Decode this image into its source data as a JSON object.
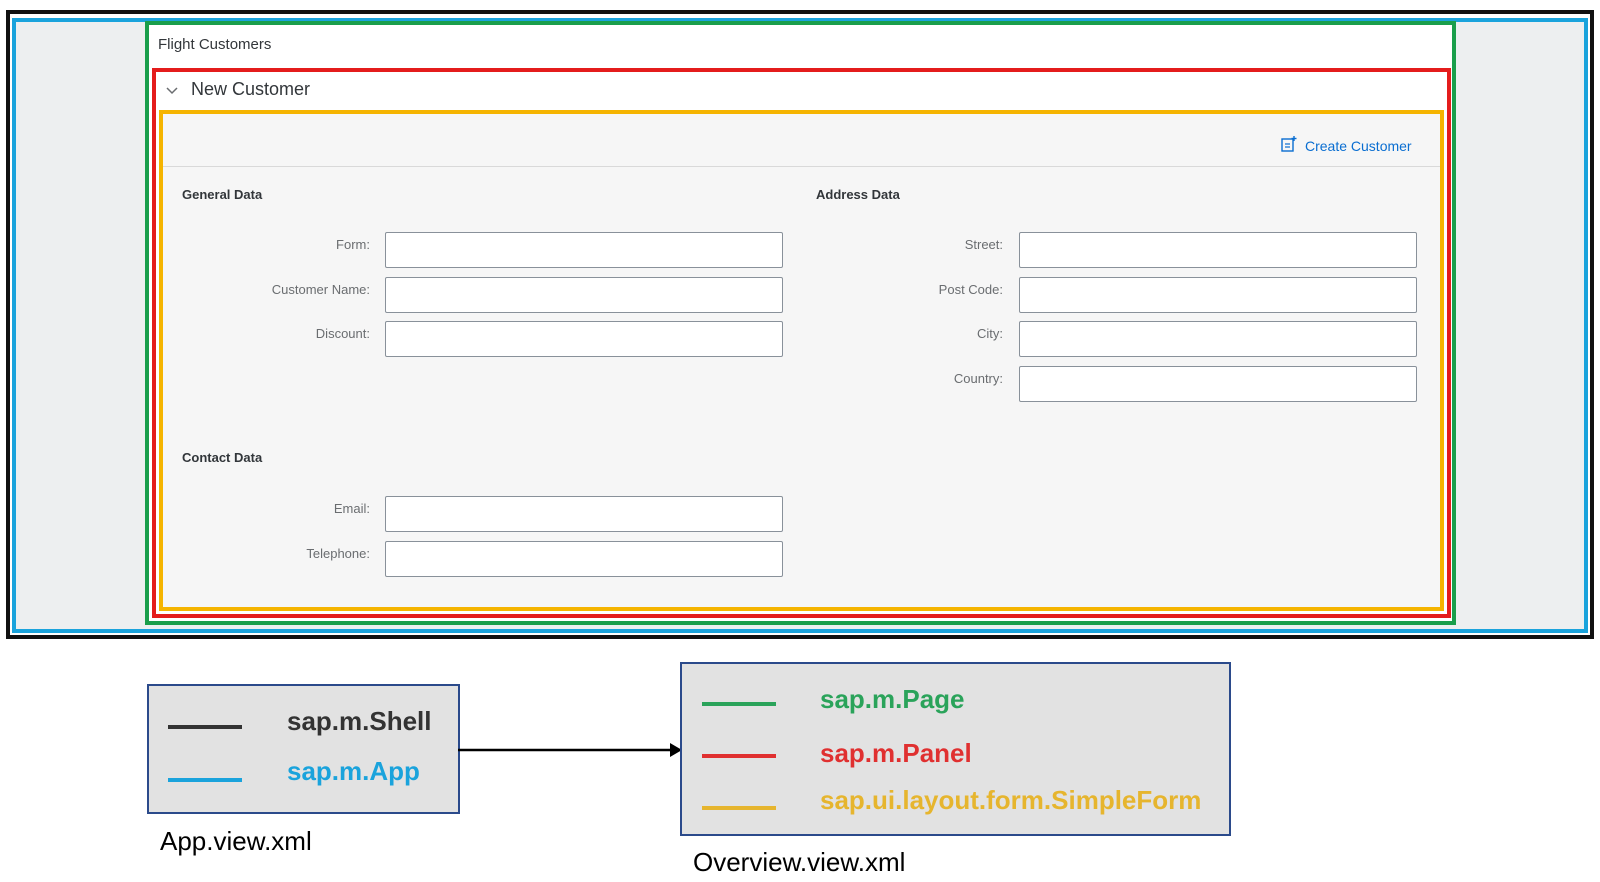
{
  "colors": {
    "shell": "#111111",
    "app": "#1aa3dc",
    "page": "#1a9e4b",
    "panel": "#e41c1c",
    "simpleform": "#f5b400",
    "link": "#0a6ed1"
  },
  "ui": {
    "page_title": "Flight Customers",
    "panel_title": "New Customer",
    "panel_icon": "chevron-down-icon",
    "create_button": {
      "label": "Create Customer",
      "icon": "create-document-icon"
    },
    "general_data": {
      "title": "General Data",
      "fields": [
        {
          "label": "Form:",
          "value": ""
        },
        {
          "label": "Customer Name:",
          "value": ""
        },
        {
          "label": "Discount:",
          "value": ""
        }
      ]
    },
    "address_data": {
      "title": "Address Data",
      "fields": [
        {
          "label": "Street:",
          "value": ""
        },
        {
          "label": "Post Code:",
          "value": ""
        },
        {
          "label": "City:",
          "value": ""
        },
        {
          "label": "Country:",
          "value": ""
        }
      ]
    },
    "contact_data": {
      "title": "Contact Data",
      "fields": [
        {
          "label": "Email:",
          "value": ""
        },
        {
          "label": "Telephone:",
          "value": ""
        }
      ]
    }
  },
  "legend": {
    "app_view": {
      "items": [
        {
          "label": "sap.m.Shell",
          "color": "#333333"
        },
        {
          "label": "sap.m.App",
          "color": "#1aa3dc"
        }
      ],
      "caption": "App.view.xml"
    },
    "overview_view": {
      "items": [
        {
          "label": "sap.m.Page",
          "color": "#2aa35a"
        },
        {
          "label": "sap.m.Panel",
          "color": "#e03030"
        },
        {
          "label": "sap.ui.layout.form.SimpleForm",
          "color": "#e6b52e"
        }
      ],
      "caption": "Overview.view.xml"
    }
  }
}
